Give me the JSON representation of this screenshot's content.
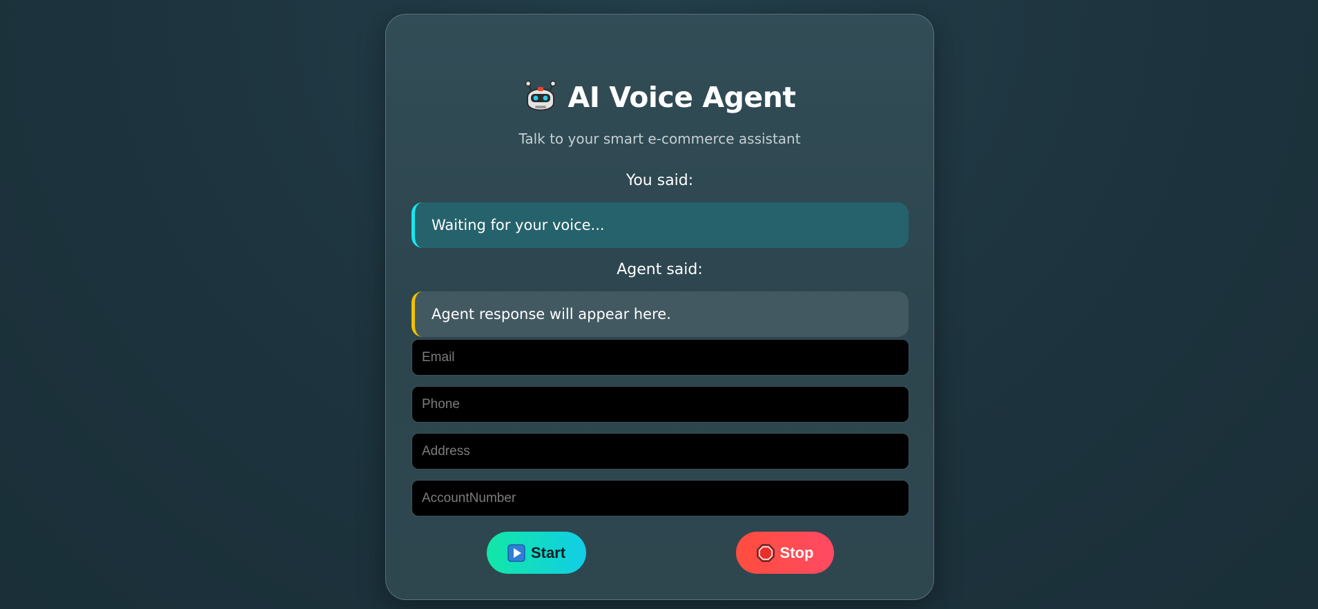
{
  "app": {
    "title": "AI Voice Agent",
    "subtitle": "Talk to your smart e-commerce assistant",
    "title_icon": "robot-icon"
  },
  "conversation": {
    "you_label": "You said:",
    "user_text": "Waiting for your voice...",
    "agent_label": "Agent said:",
    "agent_text": "Agent response will appear here."
  },
  "form": {
    "email_placeholder": "Email",
    "phone_placeholder": "Phone",
    "address_placeholder": "Address",
    "account_placeholder": "AccountNumber"
  },
  "controls": {
    "start_label": "Start",
    "start_icon": "play-icon",
    "stop_label": "Stop",
    "stop_icon": "stop-sign-icon"
  },
  "colors": {
    "user_accent": "#19e6ef",
    "agent_accent": "#f2c200",
    "start_gradient": [
      "#12e7a6",
      "#12cde6"
    ],
    "stop_gradient": [
      "#ff4d3d",
      "#ff4a63"
    ]
  }
}
